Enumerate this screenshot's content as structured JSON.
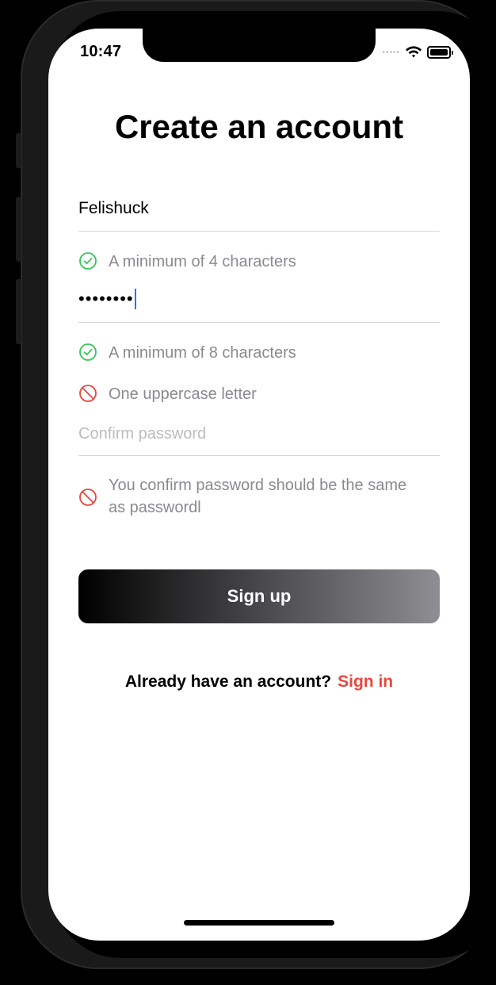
{
  "status_bar": {
    "time": "10:47",
    "icons": [
      "signal-dots",
      "wifi-icon",
      "battery-icon"
    ]
  },
  "screen": {
    "title": "Create an account"
  },
  "form": {
    "username_value": "Felishuck",
    "password_value": "••••••••",
    "confirm_placeholder": "Confirm password"
  },
  "rules": [
    {
      "text": "A minimum of 4 characters",
      "state": "ok",
      "icon": "check-circle-icon"
    },
    {
      "text": "A minimum of 8 characters",
      "state": "ok",
      "icon": "check-circle-icon"
    },
    {
      "text": "One uppercase letter",
      "state": "error",
      "icon": "prohibited-icon"
    },
    {
      "text": "You confirm password should be the same as passwordl",
      "state": "error",
      "icon": "prohibited-icon"
    }
  ],
  "actions": {
    "signup_label": "Sign up",
    "signin_prompt": "Already have an account?",
    "signin_link": "Sign in"
  },
  "colors": {
    "ok": "#34c759",
    "error": "#e5483d",
    "link": "#e5483d",
    "caret": "#2f6fe8"
  }
}
